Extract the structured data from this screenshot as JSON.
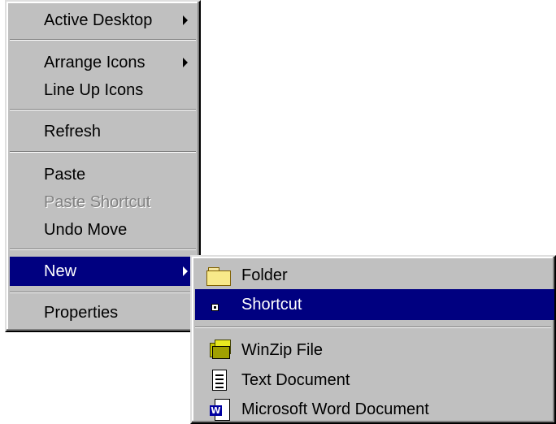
{
  "context_menu": {
    "items": [
      {
        "label": "Active Desktop",
        "accesskey": "A",
        "has_submenu": true
      },
      {
        "label": "Arrange Icons",
        "accesskey": "I",
        "has_submenu": true
      },
      {
        "label": "Line Up Icons",
        "accesskey": "U"
      },
      {
        "label": "Refresh",
        "accesskey": "e"
      },
      {
        "label": "Paste",
        "accesskey": "P"
      },
      {
        "label": "Paste Shortcut",
        "accesskey": "S",
        "disabled": true
      },
      {
        "label": "Undo Move",
        "accesskey": "U"
      },
      {
        "label": "New",
        "accesskey": "N",
        "has_submenu": true,
        "selected": true
      },
      {
        "label": "Properties",
        "accesskey": "r"
      }
    ]
  },
  "new_submenu": {
    "items": [
      {
        "label": "Folder",
        "icon": "folder-icon"
      },
      {
        "label": "Shortcut",
        "icon": "shortcut-icon",
        "selected": true
      },
      {
        "label": "WinZip File",
        "icon": "winzip-icon"
      },
      {
        "label": "Text Document",
        "icon": "text-document-icon"
      },
      {
        "label": "Microsoft Word Document",
        "icon": "word-document-icon"
      }
    ]
  },
  "colors": {
    "menu_face": "#c0c0c0",
    "highlight": "#000080",
    "highlight_text": "#ffffff",
    "disabled_text": "#808080"
  }
}
